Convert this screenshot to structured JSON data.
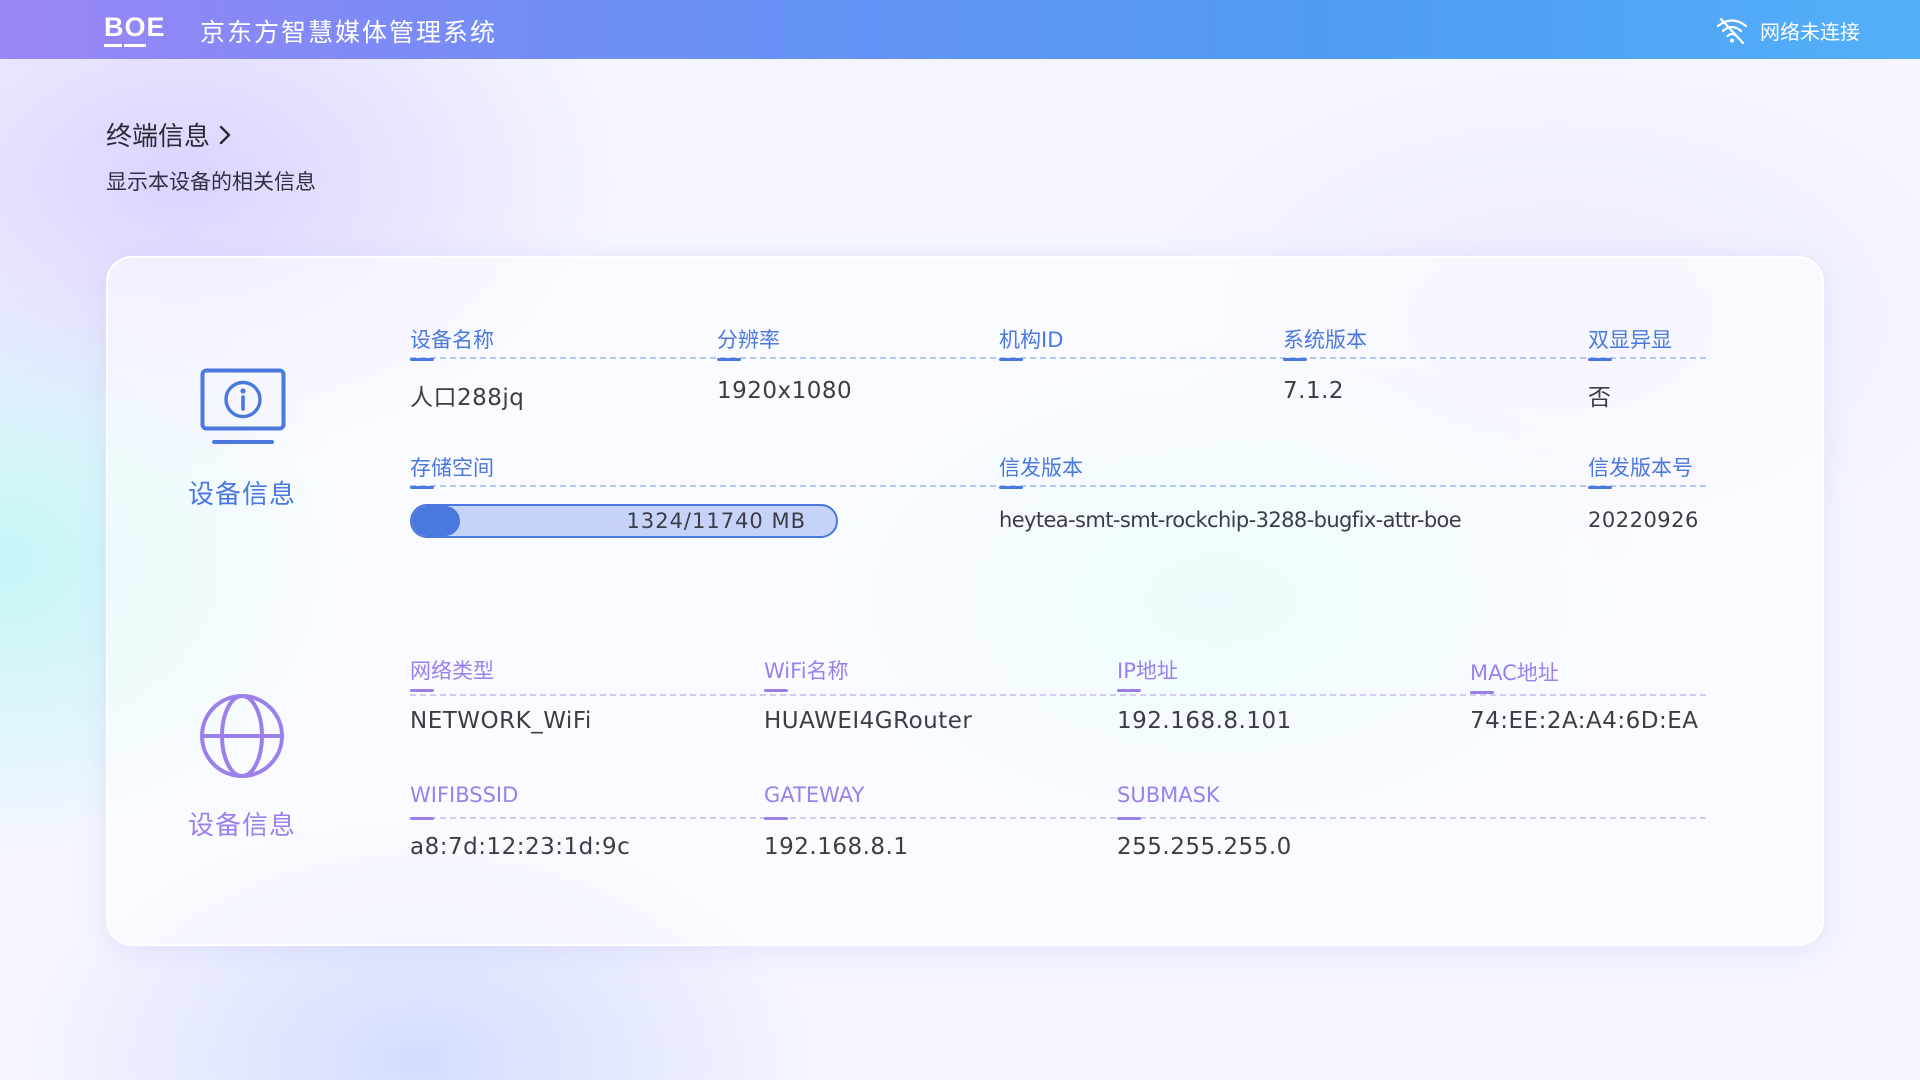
{
  "header": {
    "logo": "BOE",
    "logo_colors": [
      "#ffffff",
      "#ffffff",
      "#ffffff"
    ],
    "title": "京东方智慧媒体管理系统",
    "network_status": "网络未连接",
    "network_icon": "wifi-off-icon"
  },
  "page": {
    "title": "终端信息",
    "subtitle": "显示本设备的相关信息"
  },
  "device_section": {
    "label": "设备信息",
    "icon": "monitor-info-icon",
    "accent": "#4a78de",
    "fields": {
      "device_name": {
        "label": "设备名称",
        "value": "人口288jq"
      },
      "resolution": {
        "label": "分辨率",
        "value": "1920x1080"
      },
      "org_id": {
        "label": "机构ID",
        "value": ""
      },
      "system_version": {
        "label": "系统版本",
        "value": "7.1.2"
      },
      "dual_display": {
        "label": "双显异显",
        "value": "否"
      },
      "storage": {
        "label": "存储空间",
        "value": "1324/11740 MB",
        "used": 1324,
        "total": 11740
      },
      "release_version": {
        "label": "信发版本",
        "value": "heytea-smt-smt-rockchip-3288-bugfix-attr-boe"
      },
      "release_number": {
        "label": "信发版本号",
        "value": "20220926"
      }
    }
  },
  "network_section": {
    "label": "设备信息",
    "icon": "globe-icon",
    "accent": "#9b80ec",
    "fields": {
      "network_type": {
        "label": "网络类型",
        "value": "NETWORK_WiFi"
      },
      "wifi_name": {
        "label": "WiFi名称",
        "value": "HUAWEI4GRouter"
      },
      "ip": {
        "label": "IP地址",
        "value": "192.168.8.101"
      },
      "mac": {
        "label": "MAC地址",
        "value": "74:EE:2A:A4:6D:EA"
      },
      "bssid": {
        "label": "WIFIBSSID",
        "value": "a8:7d:12:23:1d:9c"
      },
      "gateway": {
        "label": "GATEWAY",
        "value": "192.168.8.1"
      },
      "submask": {
        "label": "SUBMASK",
        "value": "255.255.255.0"
      }
    }
  }
}
